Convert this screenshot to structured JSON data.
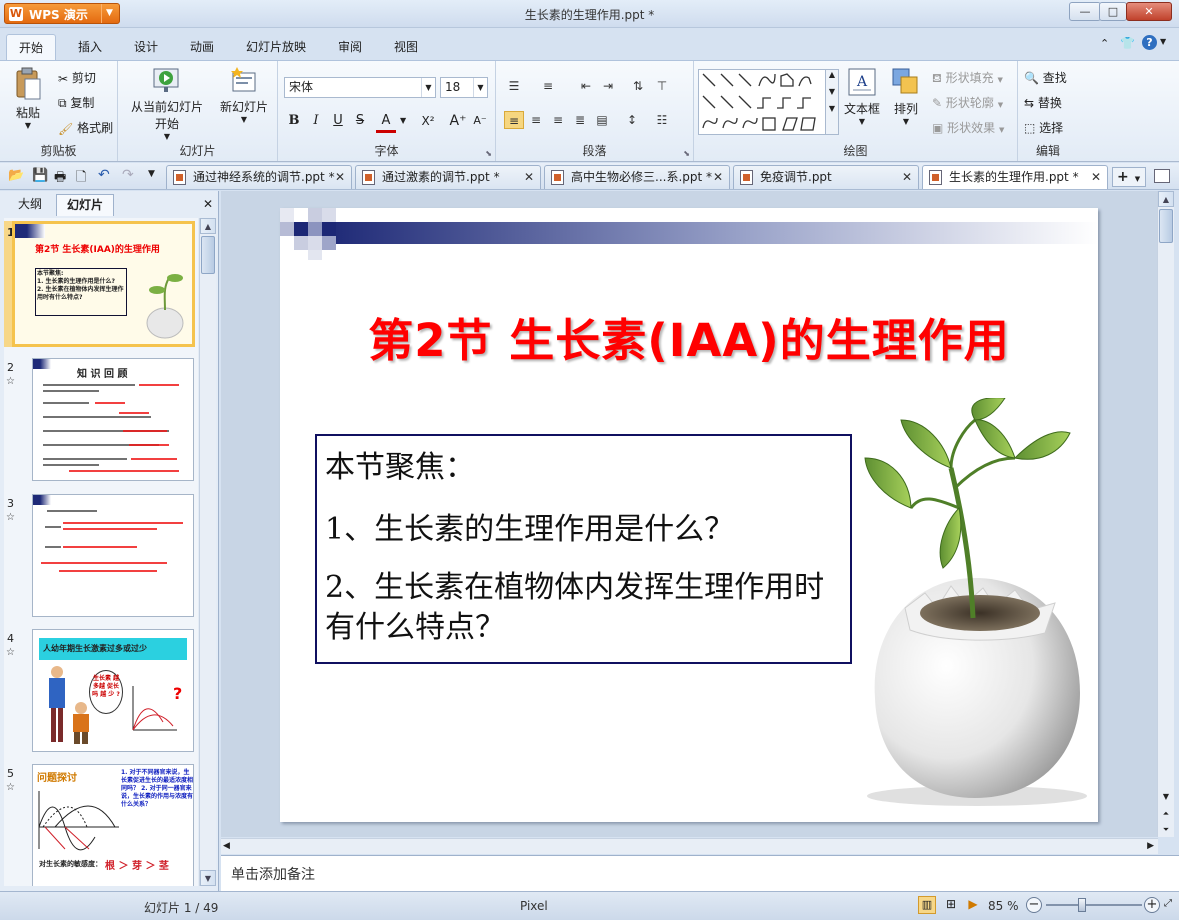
{
  "titlebar": {
    "app_name": "WPS 演示",
    "doc_title": "生长素的生理作用.ppt *",
    "min": "—",
    "max": "□",
    "close": "✕"
  },
  "ribbon_tabs": [
    "开始",
    "插入",
    "设计",
    "动画",
    "幻灯片放映",
    "审阅",
    "视图"
  ],
  "ribbon": {
    "clipboard": {
      "paste": "粘贴",
      "cut": "剪切",
      "copy": "复制",
      "format_painter": "格式刷",
      "label": "剪贴板"
    },
    "slides": {
      "from_current": "从当前幻灯片",
      "start": "开始",
      "new_slide": "新幻灯片",
      "label": "幻灯片"
    },
    "font": {
      "name": "宋体",
      "size": "18",
      "bold": "B",
      "italic": "I",
      "underline": "U",
      "strike": "S",
      "color": "A",
      "superscript": "X²",
      "grow": "A⁺",
      "shrink": "A⁻",
      "label": "字体"
    },
    "paragraph": {
      "label": "段落"
    },
    "drawing": {
      "textbox": "文本框",
      "arrange": "排列",
      "shape_fill": "形状填充",
      "shape_outline": "形状轮廓",
      "shape_effect": "形状效果",
      "label": "绘图"
    },
    "edit": {
      "find": "查找",
      "replace": "替换",
      "select": "选择",
      "label": "编辑"
    }
  },
  "doc_tabs": [
    {
      "label": "通过神经系统的调节.ppt *",
      "close": "✕"
    },
    {
      "label": "通过激素的调节.ppt *",
      "close": "✕"
    },
    {
      "label": "高中生物必修三...系.ppt *",
      "close": "✕"
    },
    {
      "label": "免疫调节.ppt",
      "close": "✕"
    },
    {
      "label": "生长素的生理作用.ppt *",
      "close": "✕"
    }
  ],
  "panel": {
    "outline_tab": "大纲",
    "slides_tab": "幻灯片",
    "close": "✕"
  },
  "thumbnails": [
    {
      "num": "1",
      "title": "第2节 生长素(IAA)的生理作用",
      "focus": "本节聚焦:",
      "q1": "1. 生长素的生理作用是什么?",
      "q2": "2. 生长素在植物体内发挥生理作用时有什么特点?"
    },
    {
      "num": "2",
      "title": "知 识 回 顾"
    },
    {
      "num": "3"
    },
    {
      "num": "4",
      "title": "人幼年期生长激素过多或过少",
      "bubble": "生长素 越多越 促长吗 越 少 ?",
      "q": "?"
    },
    {
      "num": "5",
      "title": "问题探讨",
      "note": "1. 对于不同器官来说，生长素促进生长的最适浓度相同吗？ 2. 对于同一器官来说，生长素的作用与浓度有什么关系？",
      "bottom": "对生长素的敏感度：",
      "order": "根 ＞ 芽 ＞ 茎"
    }
  ],
  "star_icon": "☆",
  "slide": {
    "title": "第2节  生长素(IAA)的生理作用",
    "focus": "本节聚焦：",
    "q1": "1、生长素的生理作用是什么？",
    "q2": "2、生长素在植物体内发挥生理作用时有什么特点？",
    "title_color": "#ff0000"
  },
  "notes_placeholder": "单击添加备注",
  "status": {
    "slide_info": "幻灯片 1 / 49",
    "theme": "Pixel",
    "zoom": "85 %"
  }
}
